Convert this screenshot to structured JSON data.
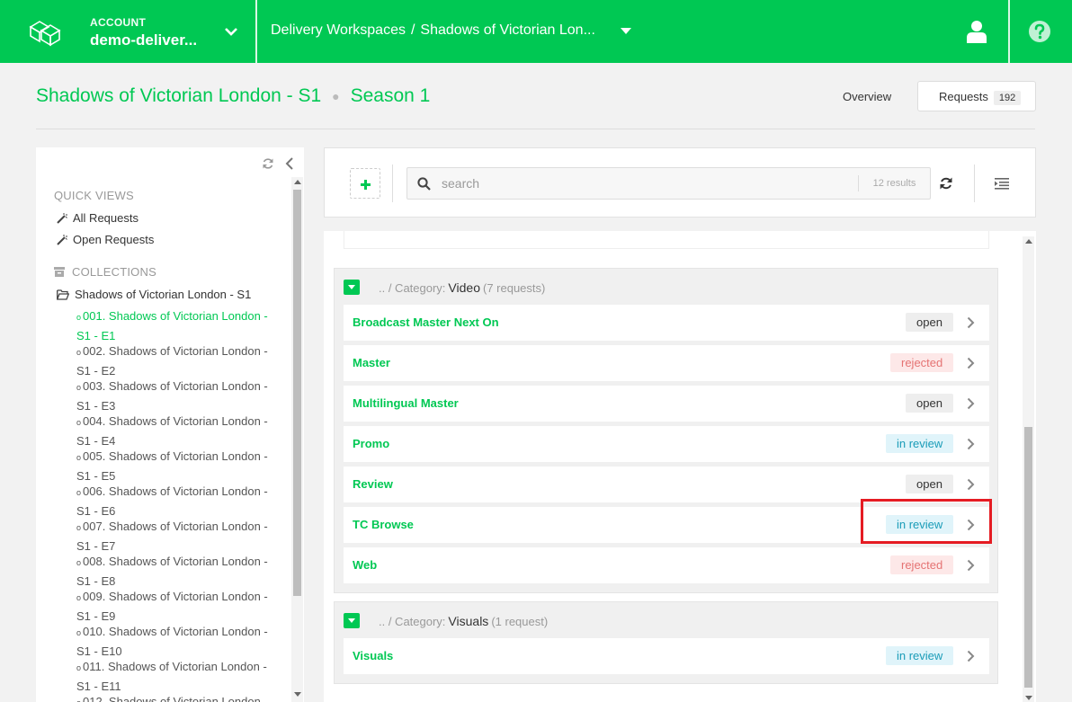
{
  "topbar": {
    "account_label": "ACCOUNT",
    "account_value": "demo-deliver...",
    "breadcrumb": [
      "Delivery Workspaces",
      "Shadows of Victorian Lon..."
    ],
    "breadcrumb_sep": "/",
    "brand_color": "#00c853"
  },
  "header": {
    "title": "Shadows of Victorian London - S1",
    "season": "Season 1",
    "overview_label": "Overview",
    "requests_label": "Requests",
    "requests_count": "192"
  },
  "sidebar": {
    "quick_views_title": "QUICK VIEWS",
    "quick_views": [
      "All Requests",
      "Open Requests"
    ],
    "collections_title": "COLLECTIONS",
    "collection_name": "Shadows of Victorian London - S1",
    "episodes": [
      "001. Shadows of Victorian London - S1 - E1",
      "002. Shadows of Victorian London - S1 - E2",
      "003. Shadows of Victorian London - S1 - E3",
      "004. Shadows of Victorian London - S1 - E4",
      "005. Shadows of Victorian London - S1 - E5",
      "006. Shadows of Victorian London - S1 - E6",
      "007. Shadows of Victorian London - S1 - E7",
      "008. Shadows of Victorian London - S1 - E8",
      "009. Shadows of Victorian London - S1 - E9",
      "010. Shadows of Victorian London - S1 - E10",
      "011. Shadows of Victorian London - S1 - E11",
      "012. Shadows of Victorian London"
    ],
    "active_episode": 0
  },
  "toolbar": {
    "search_placeholder": "search",
    "results": "12 results"
  },
  "groups": [
    {
      "path_prefix": ".. / Category:",
      "name": "Video",
      "count": "(7 requests)",
      "requests": [
        {
          "title": "Broadcast Master Next On",
          "status": "open"
        },
        {
          "title": "Master",
          "status": "rejected"
        },
        {
          "title": "Multilingual Master",
          "status": "open"
        },
        {
          "title": "Promo",
          "status": "in review"
        },
        {
          "title": "Review",
          "status": "open"
        },
        {
          "title": "TC Browse",
          "status": "in review"
        },
        {
          "title": "Web",
          "status": "rejected"
        }
      ]
    },
    {
      "path_prefix": ".. / Category:",
      "name": "Visuals",
      "count": "(1 request)",
      "requests": [
        {
          "title": "Visuals",
          "status": "in review"
        }
      ]
    }
  ],
  "status_colors": {
    "open": "#eeeeee",
    "rejected": "#fde8e8",
    "in review": "#e0f4fa",
    "highlight": "#e51c23"
  }
}
